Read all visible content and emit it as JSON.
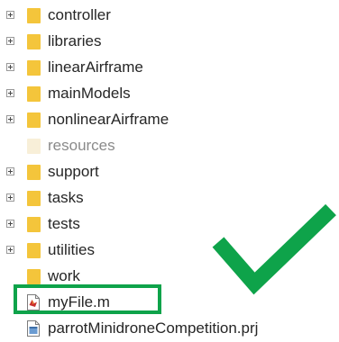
{
  "tree": {
    "items": [
      {
        "label": "controller",
        "type": "folder",
        "expandable": true,
        "faded": false
      },
      {
        "label": "libraries",
        "type": "folder",
        "expandable": true,
        "faded": false
      },
      {
        "label": "linearAirframe",
        "type": "folder",
        "expandable": true,
        "faded": false
      },
      {
        "label": "mainModels",
        "type": "folder",
        "expandable": true,
        "faded": false
      },
      {
        "label": "nonlinearAirframe",
        "type": "folder",
        "expandable": true,
        "faded": false
      },
      {
        "label": "resources",
        "type": "folder",
        "expandable": false,
        "faded": true
      },
      {
        "label": "support",
        "type": "folder",
        "expandable": true,
        "faded": false
      },
      {
        "label": "tasks",
        "type": "folder",
        "expandable": true,
        "faded": false
      },
      {
        "label": "tests",
        "type": "folder",
        "expandable": true,
        "faded": false
      },
      {
        "label": "utilities",
        "type": "folder",
        "expandable": true,
        "faded": false
      },
      {
        "label": "work",
        "type": "folder",
        "expandable": false,
        "faded": false
      },
      {
        "label": "myFile.m",
        "type": "m-file",
        "expandable": false,
        "faded": false
      },
      {
        "label": "parrotMinidroneCompetition.prj",
        "type": "project-file",
        "expandable": false,
        "faded": false
      }
    ]
  },
  "colors": {
    "folder": "#f4c53b",
    "folder_faded": "#f8efd8",
    "highlight": "#0ea34a",
    "checkmark": "#0ea34a"
  },
  "annotations": {
    "highlight_target": "myFile.m",
    "checkmark_icon": "checkmark-icon"
  }
}
